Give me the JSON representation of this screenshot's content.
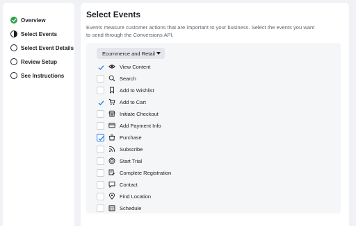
{
  "sidebar": {
    "steps": [
      {
        "label": "Overview",
        "status": "complete"
      },
      {
        "label": "Select Events",
        "status": "in-progress"
      },
      {
        "label": "Select Event Details",
        "status": "pending"
      },
      {
        "label": "Review Setup",
        "status": "pending"
      },
      {
        "label": "See Instructions",
        "status": "pending"
      }
    ]
  },
  "main": {
    "title": "Select Events",
    "description": "Events measure customer actions that are important to your business. Select the events you want to send through the Conversions API.",
    "category_select": "Ecommerce and Retail",
    "events": [
      {
        "label": "View Content",
        "icon": "eye-icon",
        "checked": true
      },
      {
        "label": "Search",
        "icon": "search-icon",
        "checked": false
      },
      {
        "label": "Add to Wishlist",
        "icon": "bookmark-icon",
        "checked": false
      },
      {
        "label": "Add to Cart",
        "icon": "cart-icon",
        "checked": true
      },
      {
        "label": "Initiate Checkout",
        "icon": "store-icon",
        "checked": false
      },
      {
        "label": "Add Payment Info",
        "icon": "credit-card-icon",
        "checked": false
      },
      {
        "label": "Purchase",
        "icon": "shopping-bag-icon",
        "checked": true
      },
      {
        "label": "Subscribe",
        "icon": "rss-icon",
        "checked": false
      },
      {
        "label": "Start Trial",
        "icon": "badge-icon",
        "checked": false
      },
      {
        "label": "Complete Registration",
        "icon": "registration-icon",
        "checked": false
      },
      {
        "label": "Contact",
        "icon": "chat-icon",
        "checked": false
      },
      {
        "label": "Find Location",
        "icon": "location-pin-icon",
        "checked": false
      },
      {
        "label": "Schedule",
        "icon": "calendar-icon",
        "checked": false
      }
    ]
  },
  "colors": {
    "accent": "#1877f2",
    "success": "#31a24c",
    "page_background": "#f0f2f5"
  }
}
